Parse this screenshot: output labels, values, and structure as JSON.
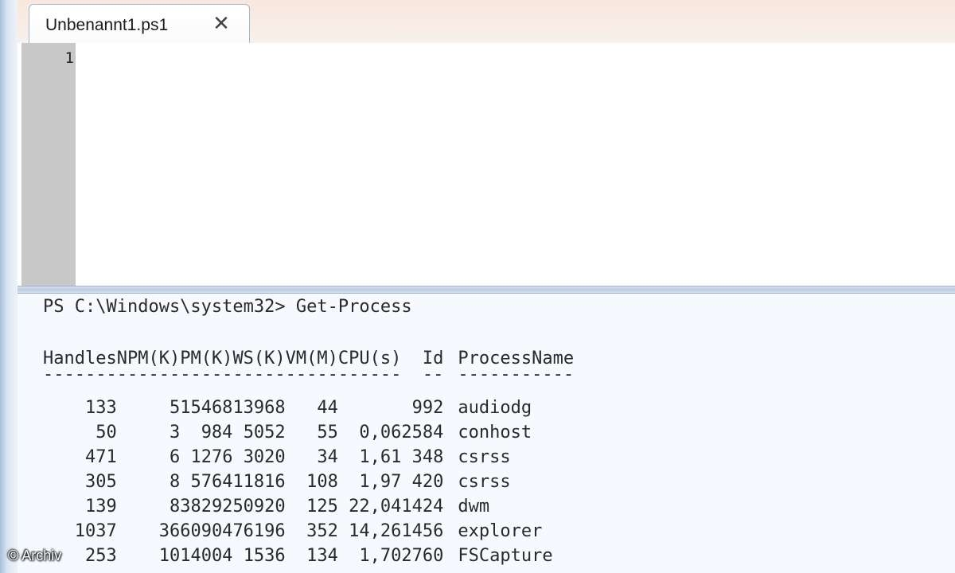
{
  "tab": {
    "label": "Unbenannt1.ps1",
    "close": "✕"
  },
  "editor": {
    "line_number": "1"
  },
  "console": {
    "prompt": "PS C:\\Windows\\system32> Get-Process",
    "headers": [
      "Handles",
      "NPM(K)",
      "PM(K)",
      "WS(K)",
      "VM(M)",
      "CPU(s)",
      "Id",
      "ProcessName"
    ],
    "dashes": [
      "-------",
      "------",
      "-----",
      "-----",
      "-----",
      "------",
      "--",
      "-----------"
    ],
    "rows": [
      [
        "133",
        "5",
        "15468",
        "13968",
        "44",
        "",
        "992",
        "audiodg"
      ],
      [
        "50",
        "3",
        "984",
        "5052",
        "55",
        "0,06",
        "2584",
        "conhost"
      ],
      [
        "471",
        "6",
        "1276",
        "3020",
        "34",
        "1,61",
        "348",
        "csrss"
      ],
      [
        "305",
        "8",
        "5764",
        "11816",
        "108",
        "1,97",
        "420",
        "csrss"
      ],
      [
        "139",
        "8",
        "38292",
        "50920",
        "125",
        "22,04",
        "1424",
        "dwm"
      ],
      [
        "1037",
        "36",
        "60904",
        "76196",
        "352",
        "14,26",
        "1456",
        "explorer"
      ],
      [
        "253",
        "10",
        "14004",
        "1536",
        "134",
        "1,70",
        "2760",
        "FSCapture"
      ]
    ]
  },
  "watermark": "© Archiv"
}
